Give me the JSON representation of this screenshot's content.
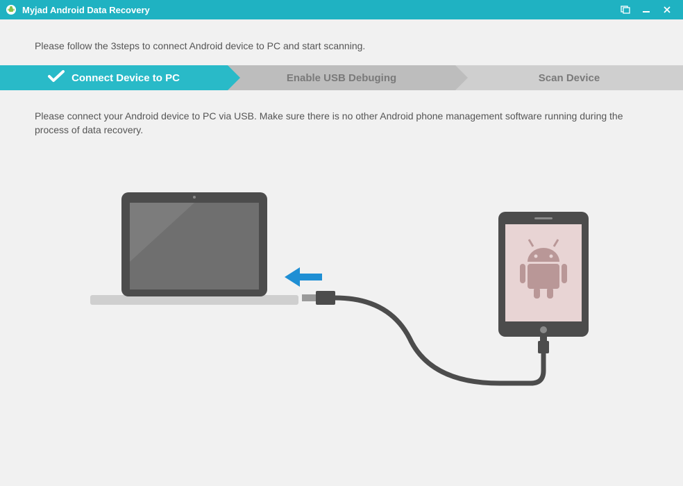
{
  "titlebar": {
    "title": "Myjad Android Data Recovery"
  },
  "intro_text": "Please follow the 3steps to connect Android device to PC and start scanning.",
  "steps": {
    "step1_label": "Connect Device to PC",
    "step2_label": "Enable USB Debuging",
    "step3_label": "Scan Device"
  },
  "body_text": "Please connect your Android device to PC via USB. Make sure there is no other Android phone management software running during the process of data recovery."
}
